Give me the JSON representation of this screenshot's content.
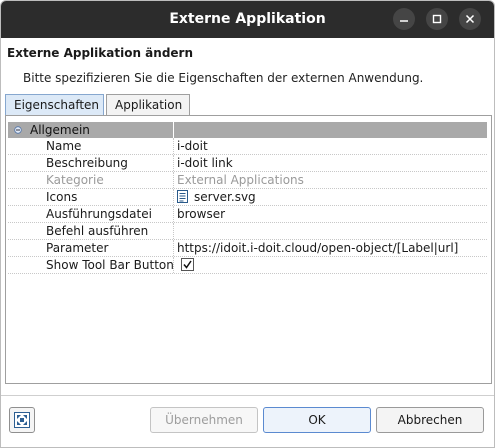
{
  "window": {
    "title": "Externe Applikation"
  },
  "header": {
    "title": "Externe Applikation ändern",
    "description": "Bitte spezifizieren Sie die Eigenschaften der externen Anwendung."
  },
  "tabs": [
    {
      "label": "Eigenschaften",
      "active": true
    },
    {
      "label": "Applikation",
      "active": false
    }
  ],
  "properties": {
    "group_label": "Allgemein",
    "rows": [
      {
        "name": "Name",
        "value": "i-doit"
      },
      {
        "name": "Beschreibung",
        "value": "i-doit link"
      },
      {
        "name": "Kategorie",
        "value": "External Applications",
        "disabled": true
      },
      {
        "name": "Icons",
        "value": "server.svg",
        "icon": "file-icon"
      },
      {
        "name": "Ausführungsdatei",
        "value": "browser"
      },
      {
        "name": "Befehl ausführen",
        "value": ""
      },
      {
        "name": "Parameter",
        "value": "https://idoit.i-doit.cloud/open-object/[Label|url]"
      },
      {
        "name": "Show Tool Bar Button",
        "value": "",
        "checked": true
      }
    ]
  },
  "footer": {
    "apply_label": "Übernehmen",
    "ok_label": "OK",
    "cancel_label": "Abbrechen"
  },
  "colors": {
    "titlebar": "#2c2c2c",
    "group_row": "#a9a9a9",
    "active_tab": "#dce9f7",
    "default_button_border": "#5b8ad0"
  }
}
